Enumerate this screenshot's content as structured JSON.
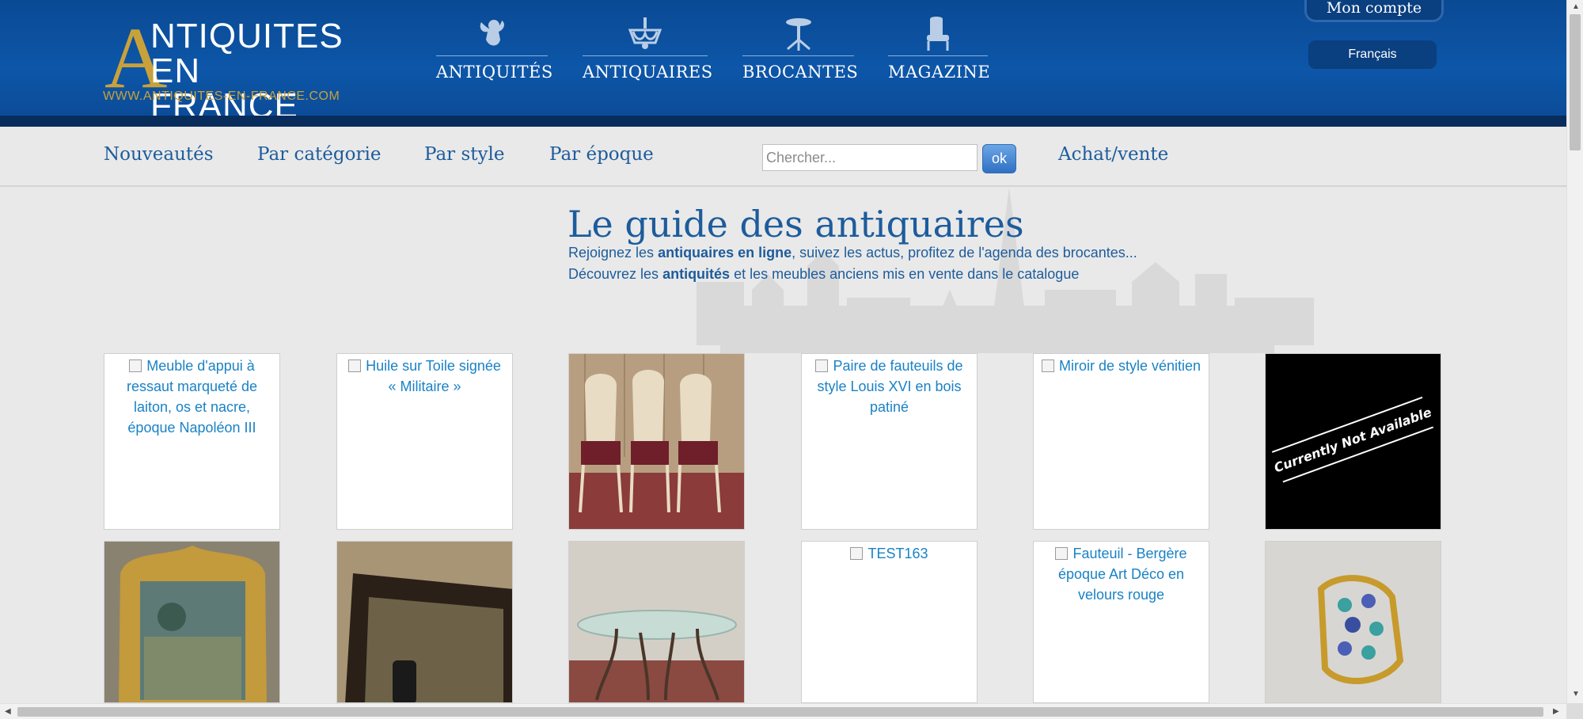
{
  "logo": {
    "big_letter": "A",
    "line1": "NTIQUITES",
    "line2": "EN FRANCE",
    "url": "WWW.ANTIQUITES-EN-FRANCE.COM"
  },
  "main_nav": [
    {
      "label": "ANTIQUITÉS",
      "icon": "cherub-icon"
    },
    {
      "label": "ANTIQUAIRES",
      "icon": "chandelier-icon"
    },
    {
      "label": "BROCANTES",
      "icon": "gueridon-table-icon"
    },
    {
      "label": "MAGAZINE",
      "icon": "armchair-icon"
    }
  ],
  "account": {
    "label": "Mon compte"
  },
  "language": {
    "label": "Français"
  },
  "sub_nav": {
    "items": [
      "Nouveautés",
      "Par catégorie",
      "Par style",
      "Par époque"
    ],
    "search_placeholder": "Chercher...",
    "search_button": "ok",
    "achat_vente": "Achat/vente"
  },
  "hero": {
    "title": "Le guide des antiquaires",
    "line1_pre": "Rejoignez les ",
    "line1_bold": "antiquaires en ligne",
    "line1_post": ", suivez les actus, profitez de l'agenda des brocantes...",
    "line2_pre": "Découvrez les ",
    "line2_bold": "antiquités",
    "line2_post": " et les meubles anciens mis en vente dans le catalogue"
  },
  "grid": {
    "row1": [
      {
        "type": "alt",
        "text": "Meuble d'appui à ressaut marqueté de laiton, os et nacre, époque Napoléon III"
      },
      {
        "type": "alt",
        "text": "Huile sur Toile signée « Militaire »"
      },
      {
        "type": "image",
        "subject": "three-chairs"
      },
      {
        "type": "alt",
        "text": "Paire de fauteuils de style Louis XVI en bois patiné"
      },
      {
        "type": "alt",
        "text": "Miroir de style vénitien"
      },
      {
        "type": "image",
        "subject": "not-available",
        "text": "Currently Not Available"
      }
    ],
    "row2": [
      {
        "type": "image",
        "subject": "gilded-mirror"
      },
      {
        "type": "image",
        "subject": "dark-mirror"
      },
      {
        "type": "image",
        "subject": "glass-table"
      },
      {
        "type": "alt",
        "text": "TEST163"
      },
      {
        "type": "alt",
        "text": "Fauteuil - Bergère époque Art Déco en velours rouge"
      },
      {
        "type": "image",
        "subject": "gem-ring"
      }
    ]
  },
  "colors": {
    "header_blue": "#0d56a8",
    "header_dark": "#082d5c",
    "gold": "#c9a13b",
    "link_blue": "#1d5c9c",
    "alt_text_blue": "#1a82c5"
  }
}
